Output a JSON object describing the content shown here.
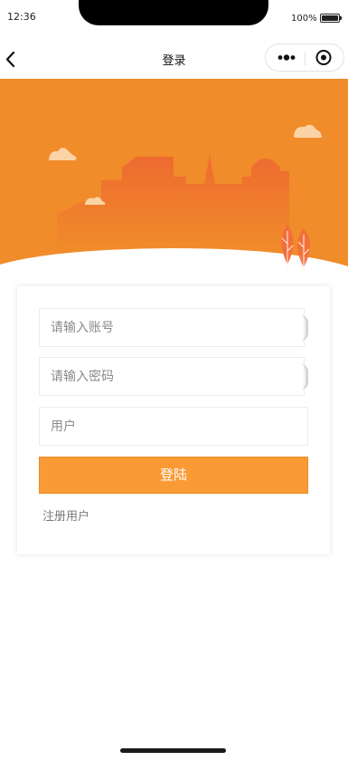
{
  "status_bar": {
    "time": "12:36",
    "battery_percent": "100%"
  },
  "navbar": {
    "title": "登录",
    "back_icon": "chevron-left-icon",
    "more_icon": "more-dots-icon",
    "close_icon": "target-circle-icon"
  },
  "banner": {
    "background_color": "#f08c2a",
    "building_color": "#ee7a2e",
    "leaf_color": "#f36d3c"
  },
  "form": {
    "account_placeholder": "请输入账号",
    "password_placeholder": "请输入密码",
    "role_placeholder": "用户",
    "login_label": "登陆",
    "register_label": "注册用户",
    "accent_color": "#fa9a35"
  }
}
